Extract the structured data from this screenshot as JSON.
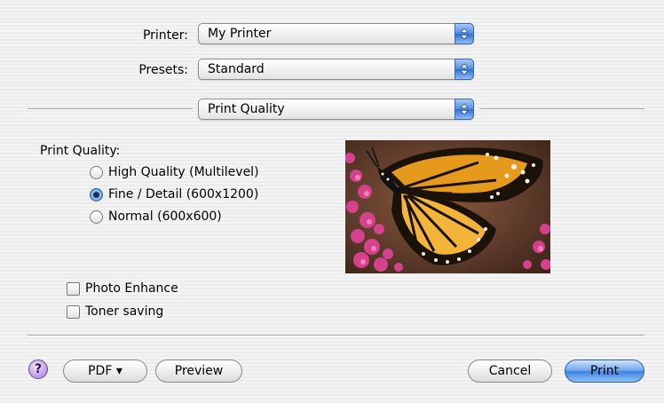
{
  "printer": {
    "label": "Printer:",
    "value": "My Printer"
  },
  "presets": {
    "label": "Presets:",
    "value": "Standard"
  },
  "panel": {
    "value": "Print Quality"
  },
  "print_quality": {
    "heading": "Print Quality:",
    "options": [
      {
        "label": "High Quality (Multilevel)",
        "selected": false
      },
      {
        "label": "Fine / Detail (600x1200)",
        "selected": true
      },
      {
        "label": "Normal (600x600)",
        "selected": false
      }
    ]
  },
  "checkboxes": [
    {
      "label": "Photo Enhance",
      "checked": false
    },
    {
      "label": "Toner saving",
      "checked": false
    }
  ],
  "buttons": {
    "help": "?",
    "pdf": "PDF ▾",
    "preview": "Preview",
    "cancel": "Cancel",
    "print": "Print"
  },
  "icons": {
    "popup_arrows": "updown-arrows-icon",
    "help": "question-icon",
    "preview_image": "butterfly-photo"
  },
  "colors": {
    "accent_blue": "#3d82e3",
    "help_purple": "#bd95e8"
  }
}
